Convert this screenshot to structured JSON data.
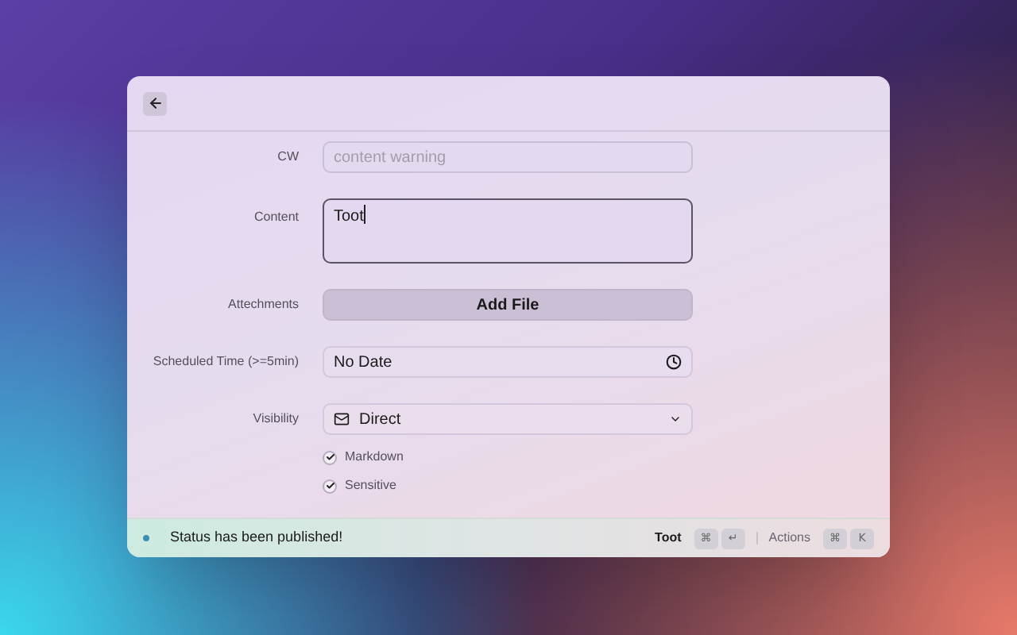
{
  "form": {
    "fields": [
      {
        "kind": "text",
        "label": "CW",
        "placeholder": "content warning"
      },
      {
        "kind": "textarea",
        "label": "Content",
        "value": "Toot"
      },
      {
        "kind": "button",
        "label": "Attechments",
        "value": "Add File"
      },
      {
        "kind": "date",
        "label": "Scheduled Time (>=5min)",
        "value": "No Date"
      },
      {
        "kind": "select",
        "label": "Visibility",
        "value": "Direct"
      }
    ],
    "checkboxes": [
      {
        "label": "Markdown",
        "checked": true
      },
      {
        "label": "Sensitive",
        "checked": true
      }
    ]
  },
  "footer": {
    "status": "Status has been published!",
    "primary_action": "Toot",
    "primary_keys": [
      "⌘",
      "↵"
    ],
    "actions_label": "Actions",
    "actions_keys": [
      "⌘",
      "K"
    ]
  }
}
